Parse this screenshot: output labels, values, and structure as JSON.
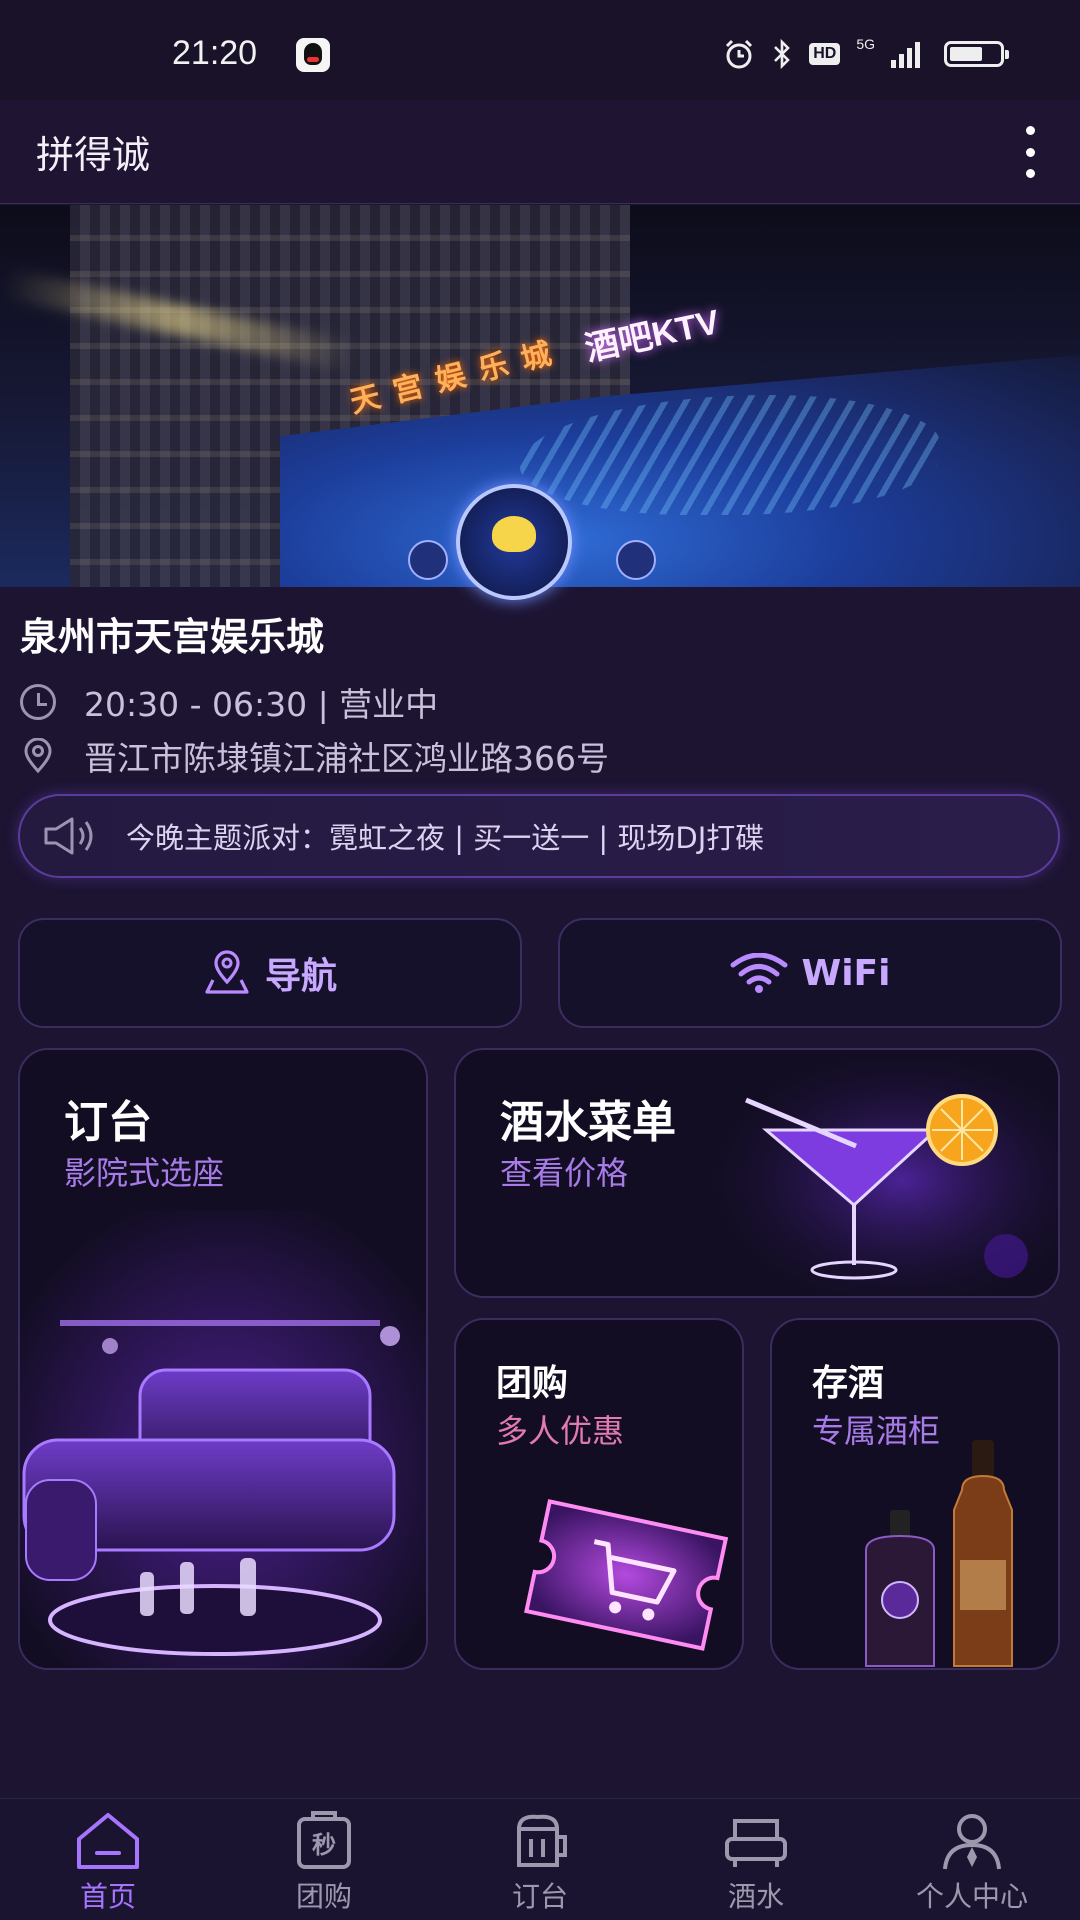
{
  "status_bar": {
    "time": "21:20",
    "network": "5G",
    "hd": "HD",
    "icons": [
      "qq-icon",
      "alarm-icon",
      "bluetooth-icon",
      "hd-icon",
      "signal-icon",
      "battery-icon"
    ]
  },
  "app_bar": {
    "title": "拼得诚",
    "menu_icon": "more-vertical-icon"
  },
  "hero": {
    "sign_cn": "天宫娱乐城",
    "sign_ktv": "酒吧KTV"
  },
  "venue": {
    "name": "泉州市天宫娱乐城",
    "hours": "20:30 - 06:30 | 营业中",
    "address": "晋江市陈埭镇江浦社区鸿业路366号"
  },
  "notice": {
    "text": "今晚主题派对：霓虹之夜 | 买一送一 | 现场DJ打碟",
    "icon": "speaker-icon"
  },
  "actions": {
    "navigate_label": "导航",
    "wifi_label": "WiFi"
  },
  "cards": {
    "booking": {
      "title": "订台",
      "subtitle": "影院式选座"
    },
    "drinks_menu": {
      "title": "酒水菜单",
      "subtitle": "查看价格"
    },
    "group_buy": {
      "title": "团购",
      "subtitle": "多人优惠"
    },
    "storage": {
      "title": "存酒",
      "subtitle": "专属酒柜"
    }
  },
  "tabs": [
    {
      "label": "首页",
      "icon": "home-icon",
      "active": true
    },
    {
      "label": "团购",
      "icon": "flash-sale-icon",
      "active": false
    },
    {
      "label": "订台",
      "icon": "table-icon",
      "active": false
    },
    {
      "label": "酒水",
      "icon": "sofa-icon",
      "active": false
    },
    {
      "label": "个人中心",
      "icon": "user-icon",
      "active": false
    }
  ],
  "colors": {
    "background": "#1d1432",
    "accent": "#a675ff",
    "card_border": "#3b2c5e",
    "group_subtitle": "#e07ab0"
  }
}
